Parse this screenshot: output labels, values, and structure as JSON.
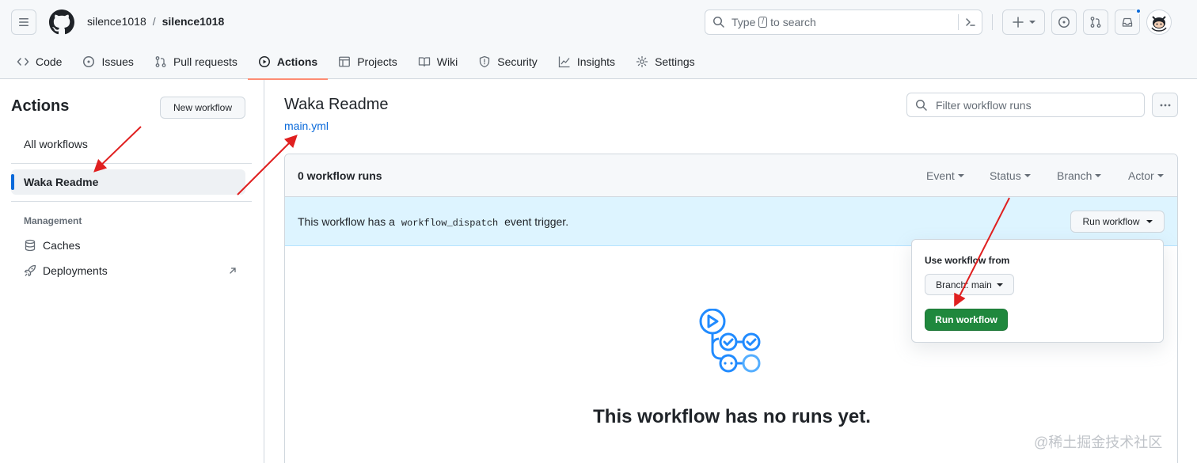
{
  "header": {
    "owner": "silence1018",
    "separator": "/",
    "repo": "silence1018",
    "search_prefix": "Type",
    "search_key": "/",
    "search_suffix": "to search"
  },
  "tabs": [
    {
      "label": "Code",
      "icon": "code-icon"
    },
    {
      "label": "Issues",
      "icon": "issue-icon"
    },
    {
      "label": "Pull requests",
      "icon": "pull-request-icon"
    },
    {
      "label": "Actions",
      "icon": "play-icon",
      "active": true
    },
    {
      "label": "Projects",
      "icon": "table-icon"
    },
    {
      "label": "Wiki",
      "icon": "book-icon"
    },
    {
      "label": "Security",
      "icon": "shield-icon"
    },
    {
      "label": "Insights",
      "icon": "graph-icon"
    },
    {
      "label": "Settings",
      "icon": "gear-icon"
    }
  ],
  "sidebar": {
    "title": "Actions",
    "new_workflow": "New workflow",
    "items": [
      {
        "label": "All workflows"
      },
      {
        "label": "Waka Readme",
        "selected": true
      }
    ],
    "management_heading": "Management",
    "management_items": [
      {
        "label": "Caches",
        "icon": "database-icon"
      },
      {
        "label": "Deployments",
        "icon": "rocket-icon"
      }
    ]
  },
  "main": {
    "title": "Waka Readme",
    "file": "main.yml",
    "filter_placeholder": "Filter workflow runs",
    "runs_count": "0 workflow runs",
    "filters": [
      "Event",
      "Status",
      "Branch",
      "Actor"
    ],
    "dispatch_pre": "This workflow has a",
    "dispatch_code": "workflow_dispatch",
    "dispatch_post": "event trigger.",
    "run_workflow": "Run workflow",
    "empty_title": "This workflow has no runs yet."
  },
  "popover": {
    "label": "Use workflow from",
    "branch": "Branch: main",
    "run_button": "Run workflow"
  },
  "watermark": "@稀土掘金技术社区",
  "colors": {
    "accent_blue": "#0969da",
    "tab_underline": "#fd8c73",
    "run_green": "#1f883d",
    "dispatch_bg": "#ddf4ff",
    "annotation_red": "#e02020"
  }
}
